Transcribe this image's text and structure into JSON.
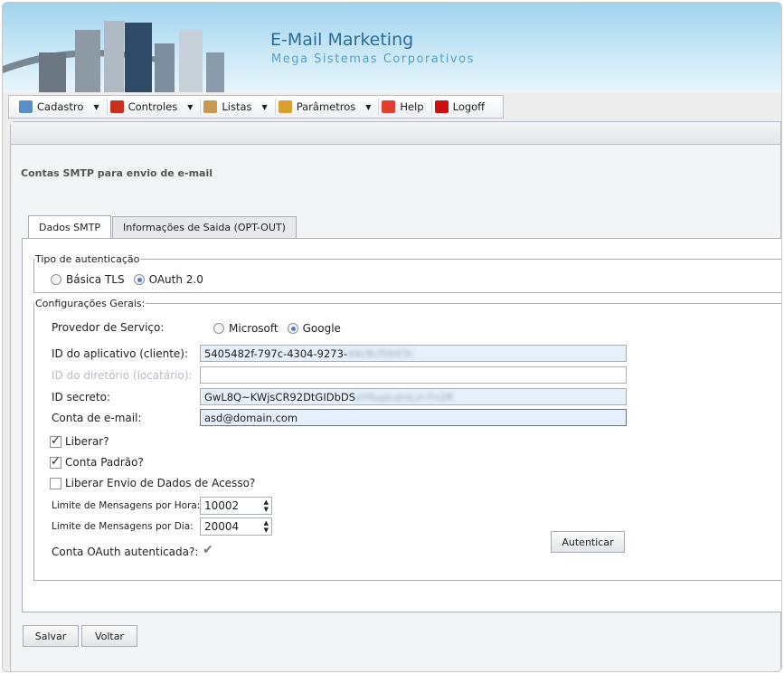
{
  "header": {
    "title": "E-Mail Marketing",
    "subtitle": "Mega Sistemas Corporativos"
  },
  "toolbar": [
    {
      "label": "Cadastro",
      "icon": "book-icon",
      "dropdown": true,
      "color": "#5a8fc8"
    },
    {
      "label": "Controles",
      "icon": "controls-icon",
      "dropdown": true,
      "color": "#c83020"
    },
    {
      "label": "Listas",
      "icon": "clipboard-icon",
      "dropdown": true,
      "color": "#c89a50"
    },
    {
      "label": "Parâmetros",
      "icon": "ruler-icon",
      "dropdown": true,
      "color": "#d8a030"
    },
    {
      "label": "Help",
      "icon": "lifebuoy-icon",
      "dropdown": false,
      "color": "#e04030"
    },
    {
      "label": "Logoff",
      "icon": "lock-icon",
      "dropdown": false,
      "color": "#cc1010"
    }
  ],
  "page_title": "Contas SMTP para envio de e-mail",
  "tabs": [
    "Dados SMTP",
    "Informações de Saida (OPT-OUT)"
  ],
  "auth": {
    "legend": "Tipo de autenticação",
    "options": [
      "Básica TLS",
      "OAuth 2.0"
    ],
    "selected": "OAuth 2.0"
  },
  "general": {
    "legend": "Configurações Gerais:",
    "provider_label": "Provedor de Serviço:",
    "providers": [
      "Microsoft",
      "Google"
    ],
    "provider_selected": "Google",
    "app_id_label": "ID do aplicativo (cliente):",
    "app_id_value": "5405482f-797c-4304-9273-",
    "app_id_hidden": "d4c8cf0b03c",
    "dir_id_label": "ID do diretório (locatário):",
    "dir_id_value": "",
    "secret_label": "ID secreto:",
    "secret_value": "GwL8Q~KWjsCR92DtGIDbDS",
    "secret_hidden": "eYKupLqrsLsl-Fo2R",
    "email_label": "Conta de e-mail:",
    "email_value": "asd@domain.com",
    "liberar": "Liberar?",
    "liberar_checked": true,
    "padrao": "Conta Padrão?",
    "padrao_checked": true,
    "envio": "Liberar Envio de Dados de Acesso?",
    "envio_checked": false,
    "hour_label": "Limite de Mensagens por Hora:",
    "hour_value": "10002",
    "day_label": "Limite de Mensagens por Dia:",
    "day_value": "20004",
    "oauth_label": "Conta OAuth autenticada?:",
    "oauth_check": "✔",
    "auth_button": "Autenticar"
  },
  "buttons": {
    "save": "Salvar",
    "back": "Voltar"
  }
}
